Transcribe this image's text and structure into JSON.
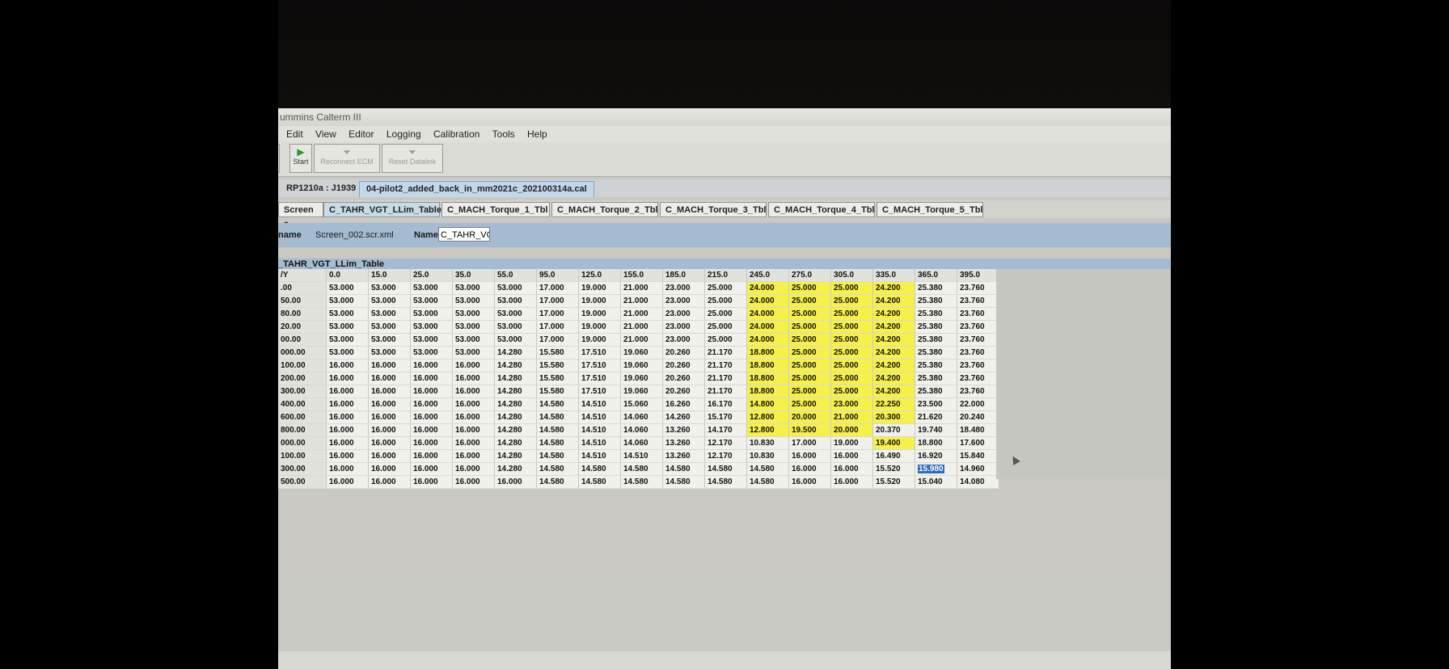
{
  "window": {
    "title": "ummins Calterm III"
  },
  "menu": [
    "Edit",
    "View",
    "Editor",
    "Logging",
    "Calibration",
    "Tools",
    "Help"
  ],
  "toolbar": {
    "start_label": "Start",
    "reconnect_label": "Reconnect ECM",
    "reset_label": "Reset Datalink"
  },
  "file_tabs": [
    "RP1210a : J1939",
    "04-pilot2_added_back_in_mm2021c_202100314a.cal"
  ],
  "screen_tabs": [
    "Screen 0",
    "C_TAHR_VGT_LLim_Table",
    "C_MACH_Torque_1_Tbl",
    "C_MACH_Torque_2_Tbl",
    "C_MACH_Torque_3_Tbl",
    "C_MACH_Torque_4_Tbl",
    "C_MACH_Torque_5_Tbl"
  ],
  "namebar": {
    "filename_label": "name",
    "filename_value": "Screen_002.scr.xml",
    "name_label": "Name",
    "name_value": "C_TAHR_VG"
  },
  "table": {
    "title": "_TAHR_VGT_LLim_Table",
    "corner": "/Y",
    "columns": [
      "0.0",
      "15.0",
      "25.0",
      "35.0",
      "55.0",
      "95.0",
      "125.0",
      "155.0",
      "185.0",
      "215.0",
      "245.0",
      "275.0",
      "305.0",
      "335.0",
      "365.0",
      "395.0"
    ],
    "rows": [
      {
        "label": ".00",
        "values": [
          "53.000",
          "53.000",
          "53.000",
          "53.000",
          "53.000",
          "17.000",
          "19.000",
          "21.000",
          "23.000",
          "25.000",
          "24.000",
          "25.000",
          "25.000",
          "24.200",
          "25.380",
          "23.760"
        ]
      },
      {
        "label": "50.00",
        "values": [
          "53.000",
          "53.000",
          "53.000",
          "53.000",
          "53.000",
          "17.000",
          "19.000",
          "21.000",
          "23.000",
          "25.000",
          "24.000",
          "25.000",
          "25.000",
          "24.200",
          "25.380",
          "23.760"
        ]
      },
      {
        "label": "80.00",
        "values": [
          "53.000",
          "53.000",
          "53.000",
          "53.000",
          "53.000",
          "17.000",
          "19.000",
          "21.000",
          "23.000",
          "25.000",
          "24.000",
          "25.000",
          "25.000",
          "24.200",
          "25.380",
          "23.760"
        ]
      },
      {
        "label": "20.00",
        "values": [
          "53.000",
          "53.000",
          "53.000",
          "53.000",
          "53.000",
          "17.000",
          "19.000",
          "21.000",
          "23.000",
          "25.000",
          "24.000",
          "25.000",
          "25.000",
          "24.200",
          "25.380",
          "23.760"
        ]
      },
      {
        "label": "00.00",
        "values": [
          "53.000",
          "53.000",
          "53.000",
          "53.000",
          "53.000",
          "17.000",
          "19.000",
          "21.000",
          "23.000",
          "25.000",
          "24.000",
          "25.000",
          "25.000",
          "24.200",
          "25.380",
          "23.760"
        ]
      },
      {
        "label": "000.00",
        "values": [
          "53.000",
          "53.000",
          "53.000",
          "53.000",
          "14.280",
          "15.580",
          "17.510",
          "19.060",
          "20.260",
          "21.170",
          "18.800",
          "25.000",
          "25.000",
          "24.200",
          "25.380",
          "23.760"
        ]
      },
      {
        "label": "100.00",
        "values": [
          "16.000",
          "16.000",
          "16.000",
          "16.000",
          "14.280",
          "15.580",
          "17.510",
          "19.060",
          "20.260",
          "21.170",
          "18.800",
          "25.000",
          "25.000",
          "24.200",
          "25.380",
          "23.760"
        ]
      },
      {
        "label": "200.00",
        "values": [
          "16.000",
          "16.000",
          "16.000",
          "16.000",
          "14.280",
          "15.580",
          "17.510",
          "19.060",
          "20.260",
          "21.170",
          "18.800",
          "25.000",
          "25.000",
          "24.200",
          "25.380",
          "23.760"
        ]
      },
      {
        "label": "300.00",
        "values": [
          "16.000",
          "16.000",
          "16.000",
          "16.000",
          "14.280",
          "15.580",
          "17.510",
          "19.060",
          "20.260",
          "21.170",
          "18.800",
          "25.000",
          "25.000",
          "24.200",
          "25.380",
          "23.760"
        ]
      },
      {
        "label": "400.00",
        "values": [
          "16.000",
          "16.000",
          "16.000",
          "16.000",
          "14.280",
          "14.580",
          "14.510",
          "15.060",
          "16.260",
          "16.170",
          "14.800",
          "25.000",
          "23.000",
          "22.250",
          "23.500",
          "22.000"
        ]
      },
      {
        "label": "600.00",
        "values": [
          "16.000",
          "16.000",
          "16.000",
          "16.000",
          "14.280",
          "14.580",
          "14.510",
          "14.060",
          "14.260",
          "15.170",
          "12.800",
          "20.000",
          "21.000",
          "20.300",
          "21.620",
          "20.240"
        ]
      },
      {
        "label": "800.00",
        "values": [
          "16.000",
          "16.000",
          "16.000",
          "16.000",
          "14.280",
          "14.580",
          "14.510",
          "14.060",
          "13.260",
          "14.170",
          "12.800",
          "19.500",
          "20.000",
          "20.370",
          "19.740",
          "18.480"
        ]
      },
      {
        "label": "000.00",
        "values": [
          "16.000",
          "16.000",
          "16.000",
          "16.000",
          "14.280",
          "14.580",
          "14.510",
          "14.060",
          "13.260",
          "12.170",
          "10.830",
          "17.000",
          "19.000",
          "19.400",
          "18.800",
          "17.600"
        ]
      },
      {
        "label": "100.00",
        "values": [
          "16.000",
          "16.000",
          "16.000",
          "16.000",
          "14.280",
          "14.580",
          "14.510",
          "14.510",
          "13.260",
          "12.170",
          "10.830",
          "16.000",
          "16.000",
          "16.490",
          "16.920",
          "15.840"
        ]
      },
      {
        "label": "300.00",
        "values": [
          "16.000",
          "16.000",
          "16.000",
          "16.000",
          "14.280",
          "14.580",
          "14.580",
          "14.580",
          "14.580",
          "14.580",
          "14.580",
          "16.000",
          "16.000",
          "15.520",
          "15.980",
          "14.960"
        ]
      },
      {
        "label": "500.00",
        "values": [
          "16.000",
          "16.000",
          "16.000",
          "16.000",
          "16.000",
          "14.580",
          "14.580",
          "14.580",
          "14.580",
          "14.580",
          "14.580",
          "16.000",
          "16.000",
          "15.520",
          "15.040",
          "14.080"
        ]
      }
    ],
    "highlight_color": "#f5f04a",
    "selected_cell": {
      "row": 14,
      "col": 14
    }
  }
}
